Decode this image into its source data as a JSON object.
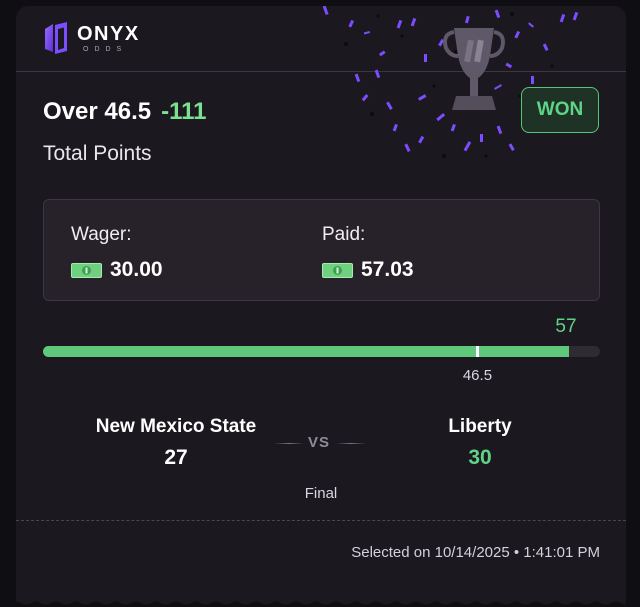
{
  "brand": {
    "name": "ONYX",
    "sub": "ODDS"
  },
  "bet": {
    "selection": "Over 46.5",
    "odds": "-111",
    "market": "Total Points",
    "status": "WON"
  },
  "money": {
    "wager_label": "Wager:",
    "wager_value": "30.00",
    "paid_label": "Paid:",
    "paid_value": "57.03"
  },
  "progress": {
    "current": "57",
    "line": "46.5",
    "current_fraction": 0.945,
    "line_fraction": 0.78
  },
  "game": {
    "home_team": "New Mexico State",
    "home_score": "27",
    "away_team": "Liberty",
    "away_score": "30",
    "vs": "VS",
    "status": "Final"
  },
  "footer": {
    "selected": "Selected on 10/14/2025 • 1:41:01 PM"
  },
  "colors": {
    "accent_green": "#5fd386",
    "brand_purple": "#7c4dff"
  }
}
